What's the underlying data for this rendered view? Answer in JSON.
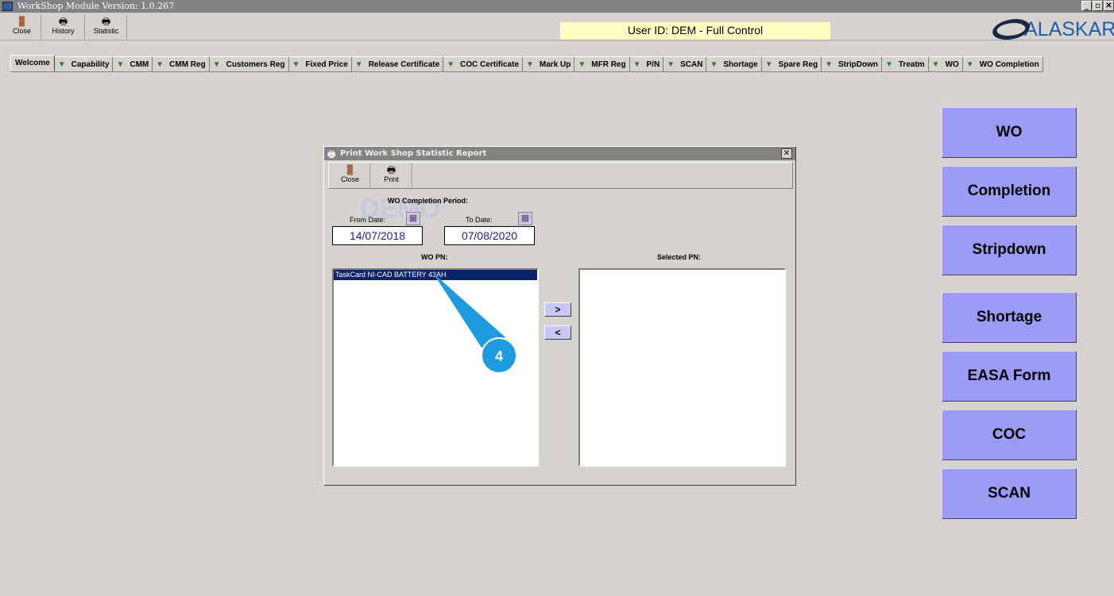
{
  "window": {
    "title": "WorkShop Module  Version: 1.0.267",
    "controls": [
      "_",
      "🗗",
      "✕"
    ]
  },
  "toolbar": {
    "close": "Close",
    "history": "History",
    "statistic": "Statistic"
  },
  "user_id": "User ID: DEM - Full Control",
  "logo": "ALASKAR",
  "tabs": [
    "Welcome",
    "Capability",
    "CMM",
    "CMM Reg",
    "Customers Reg",
    "Fixed Price",
    "Release Certificate",
    "COC Certificate",
    "Mark Up",
    "MFR Reg",
    "P/N",
    "SCAN",
    "Shortage",
    "Spare Reg",
    "StripDown",
    "Treatm",
    "WO",
    "WO Completion"
  ],
  "dialog": {
    "title": "Print Work Shop Statistic Report",
    "close": "Close",
    "print": "Print",
    "period_label": "WO Completion Period:",
    "watermark": "DEMO",
    "from_label": "From Date:",
    "from_value": "14/07/2018",
    "to_label": "To Date:",
    "to_value": "07/08/2020",
    "wo_pn_label": "WO PN:",
    "selected_pn_label": "Selected PN:",
    "wo_pn_items": [
      "TaskCard  NI-CAD BATTERY 43AH"
    ],
    "add": ">",
    "remove": "<"
  },
  "callout": "4",
  "side_buttons": [
    "WO",
    "Completion",
    "Stripdown",
    "Shortage",
    "EASA Form",
    "COC",
    "SCAN"
  ],
  "colors": {
    "side_button": "#9c9cf7",
    "selection": "#0a246a",
    "callout": "#1e9be0"
  }
}
